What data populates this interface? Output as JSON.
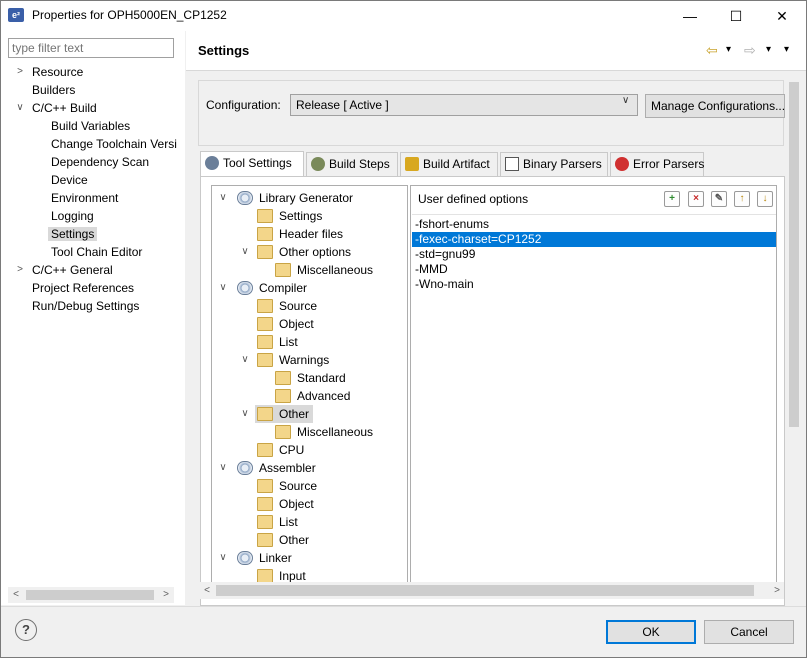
{
  "window": {
    "title": "Properties for OPH5000EN_CP1252",
    "minimize": "—",
    "maximize": "☐",
    "close": "✕",
    "app_icon_text": "e²"
  },
  "left_nav": {
    "filter_placeholder": "type filter text",
    "items": [
      {
        "label": "Resource",
        "arrow": ">",
        "level": 0
      },
      {
        "label": "Builders",
        "arrow": "",
        "level": 0
      },
      {
        "label": "C/C++ Build",
        "arrow": "v",
        "level": 0
      },
      {
        "label": "Build Variables",
        "arrow": "",
        "level": 1
      },
      {
        "label": "Change Toolchain Versi",
        "arrow": "",
        "level": 1
      },
      {
        "label": "Dependency Scan",
        "arrow": "",
        "level": 1
      },
      {
        "label": "Device",
        "arrow": "",
        "level": 1
      },
      {
        "label": "Environment",
        "arrow": "",
        "level": 1
      },
      {
        "label": "Logging",
        "arrow": "",
        "level": 1
      },
      {
        "label": "Settings",
        "arrow": "",
        "level": 1,
        "selected": true
      },
      {
        "label": "Tool Chain Editor",
        "arrow": "",
        "level": 1
      },
      {
        "label": "C/C++ General",
        "arrow": ">",
        "level": 0
      },
      {
        "label": "Project References",
        "arrow": "",
        "level": 0
      },
      {
        "label": "Run/Debug Settings",
        "arrow": "",
        "level": 0
      }
    ]
  },
  "header": {
    "title": "Settings",
    "back_icon": "⇦",
    "forward_icon": "⇨",
    "menu_icon": "▾"
  },
  "configuration": {
    "label": "Configuration:",
    "value": "Release  [ Active ]",
    "manage_label": "Manage Configurations..."
  },
  "tabs": [
    {
      "label": "Tool Settings",
      "icon": "tool-settings-icon",
      "active": true
    },
    {
      "label": "Build Steps",
      "icon": "build-steps-icon"
    },
    {
      "label": "Build Artifact",
      "icon": "build-artifact-icon"
    },
    {
      "label": "Binary Parsers",
      "icon": "binary-parsers-icon"
    },
    {
      "label": "Error Parsers",
      "icon": "error-parsers-icon"
    }
  ],
  "tool_tree": [
    {
      "label": "Library Generator",
      "type": "tool",
      "level": 0,
      "arrow": "v"
    },
    {
      "label": "Settings",
      "type": "folder",
      "level": 1,
      "arrow": ""
    },
    {
      "label": "Header files",
      "type": "folder",
      "level": 1,
      "arrow": ""
    },
    {
      "label": "Other options",
      "type": "folder",
      "level": 1,
      "arrow": "v"
    },
    {
      "label": "Miscellaneous",
      "type": "folder",
      "level": 2,
      "arrow": ""
    },
    {
      "label": "Compiler",
      "type": "tool",
      "level": 0,
      "arrow": "v"
    },
    {
      "label": "Source",
      "type": "folder",
      "level": 1,
      "arrow": ""
    },
    {
      "label": "Object",
      "type": "folder",
      "level": 1,
      "arrow": ""
    },
    {
      "label": "List",
      "type": "folder",
      "level": 1,
      "arrow": ""
    },
    {
      "label": "Warnings",
      "type": "folder",
      "level": 1,
      "arrow": "v"
    },
    {
      "label": "Standard",
      "type": "folder",
      "level": 2,
      "arrow": ""
    },
    {
      "label": "Advanced",
      "type": "folder",
      "level": 2,
      "arrow": ""
    },
    {
      "label": "Other",
      "type": "folder",
      "level": 1,
      "arrow": "v",
      "selected": true
    },
    {
      "label": "Miscellaneous",
      "type": "folder",
      "level": 2,
      "arrow": ""
    },
    {
      "label": "CPU",
      "type": "folder",
      "level": 1,
      "arrow": ""
    },
    {
      "label": "Assembler",
      "type": "tool",
      "level": 0,
      "arrow": "v"
    },
    {
      "label": "Source",
      "type": "folder",
      "level": 1,
      "arrow": ""
    },
    {
      "label": "Object",
      "type": "folder",
      "level": 1,
      "arrow": ""
    },
    {
      "label": "List",
      "type": "folder",
      "level": 1,
      "arrow": ""
    },
    {
      "label": "Other",
      "type": "folder",
      "level": 1,
      "arrow": ""
    },
    {
      "label": "Linker",
      "type": "tool",
      "level": 0,
      "arrow": "v"
    },
    {
      "label": "Input",
      "type": "folder",
      "level": 1,
      "arrow": ""
    }
  ],
  "options": {
    "header": "User defined options",
    "toolbar": [
      {
        "icon": "add-icon",
        "glyph": "+",
        "color": "#2e8b2e"
      },
      {
        "icon": "delete-icon",
        "glyph": "×",
        "color": "#c62828"
      },
      {
        "icon": "edit-icon",
        "glyph": "✎",
        "color": "#555555"
      },
      {
        "icon": "move-up-icon",
        "glyph": "↑",
        "color": "#b8860b"
      },
      {
        "icon": "move-down-icon",
        "glyph": "↓",
        "color": "#b8860b"
      }
    ],
    "values": [
      {
        "text": "-fshort-enums"
      },
      {
        "text": "-fexec-charset=CP1252",
        "selected": true
      },
      {
        "text": "-std=gnu99"
      },
      {
        "text": "-MMD"
      },
      {
        "text": "-Wno-main"
      }
    ]
  },
  "buttons": {
    "help": "?",
    "ok": "OK",
    "cancel": "Cancel"
  },
  "colors": {
    "selection": "#0078d7",
    "tree_selection": "#d9d9d9"
  }
}
